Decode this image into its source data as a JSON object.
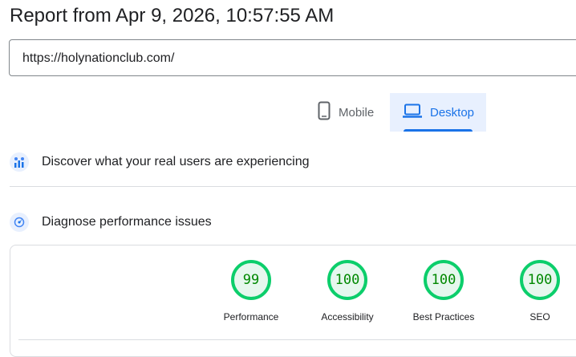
{
  "report": {
    "title": "Report from Apr 9, 2026, 10:57:55 AM",
    "url": "https://holynationclub.com/"
  },
  "tabs": [
    {
      "label": "Mobile",
      "icon": "phone-icon",
      "selected": false
    },
    {
      "label": "Desktop",
      "icon": "laptop-icon",
      "selected": true
    }
  ],
  "sections": {
    "real_users": {
      "label": "Discover what your real users are experiencing",
      "icon": "users-chart-icon"
    },
    "diagnose": {
      "label": "Diagnose performance issues",
      "icon": "lighthouse-icon"
    }
  },
  "scores": [
    {
      "value": "99",
      "label": "Performance"
    },
    {
      "value": "100",
      "label": "Accessibility"
    },
    {
      "value": "100",
      "label": "Best Practices"
    },
    {
      "value": "100",
      "label": "SEO"
    }
  ],
  "colors": {
    "pass_green": "#0cce6b",
    "pass_text": "#008800",
    "accent_blue": "#1a73e8",
    "tab_selected_bg": "#e8f0fe"
  }
}
